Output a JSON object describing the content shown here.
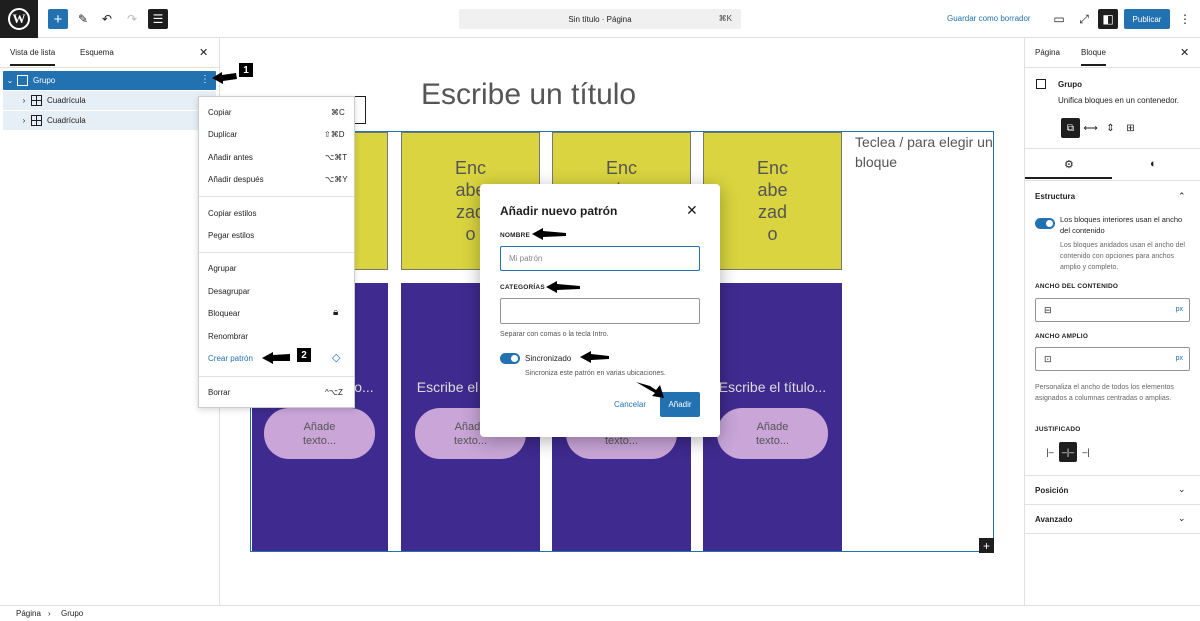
{
  "topbar": {
    "doc_title": "Sin título · Página",
    "doc_shortcut": "⌘K",
    "save_draft": "Guardar como borrador",
    "publish": "Publicar"
  },
  "left_panel": {
    "tabs": [
      "Vista de lista",
      "Esquema"
    ],
    "rows": [
      {
        "label": "Grupo",
        "icon": "group-icon",
        "selected": true
      },
      {
        "label": "Cuadrícula",
        "icon": "grid-icon"
      },
      {
        "label": "Cuadrícula",
        "icon": "grid-icon"
      }
    ]
  },
  "context_menu": {
    "items": [
      {
        "label": "Copiar",
        "shortcut": "⌘C"
      },
      {
        "label": "Duplicar",
        "shortcut": "⇧⌘D"
      },
      {
        "label": "Añadir antes",
        "shortcut": "⌥⌘T"
      },
      {
        "label": "Añadir después",
        "shortcut": "⌥⌘Y"
      },
      {
        "label": "Copiar estilos",
        "shortcut": ""
      },
      {
        "label": "Pegar estilos",
        "shortcut": ""
      },
      {
        "label": "Agrupar",
        "shortcut": ""
      },
      {
        "label": "Desagrupar",
        "shortcut": ""
      },
      {
        "label": "Bloquear",
        "shortcut": "lock-icon"
      },
      {
        "label": "Renombrar",
        "shortcut": ""
      },
      {
        "label": "Crear patrón",
        "shortcut": "pattern-icon"
      },
      {
        "label": "Borrar",
        "shortcut": "^⌥Z"
      }
    ]
  },
  "canvas": {
    "title_placeholder": "Escribe un título",
    "yellow_heading": "Enc\nabe\nzad\no",
    "purple_heading": "Escribe el título...",
    "pill_text": "Añade\ntexto...",
    "placeholder": "Teclea / para elegir un bloque",
    "colors": {
      "yellow": "#d9d43f",
      "purple": "#3f2a8f",
      "pill": "#c9a5d8"
    }
  },
  "modal": {
    "title": "Añadir nuevo patrón",
    "name_label": "NOMBRE",
    "name_placeholder": "Mi patrón",
    "categories_label": "CATEGORÍAS",
    "categories_help": "Separar con comas o la tecla Intro.",
    "sync_label": "Sincronizado",
    "sync_help": "Sincroniza este patrón en varias ubicaciones.",
    "cancel": "Cancelar",
    "add": "Añadir"
  },
  "right_panel": {
    "tabs": [
      "Página",
      "Bloque"
    ],
    "block_name": "Grupo",
    "block_desc": "Unifica bloques en un contenedor.",
    "structure": "Estructura",
    "inner_toggle": "Los bloques interiores usan el ancho del contenido",
    "inner_help": "Los bloques anidados usan el ancho del contenido con opciones para anchos amplio y completo.",
    "content_width_label": "ANCHO DEL CONTENIDO",
    "wide_width_label": "ANCHO AMPLIO",
    "unit": "px",
    "width_help": "Personaliza el ancho de todos los elementos asignados a columnas centradas o amplias.",
    "justify_label": "JUSTIFICADO",
    "position": "Posición",
    "advanced": "Avanzado"
  },
  "footer": {
    "crumbs": [
      "Página",
      "Grupo"
    ]
  },
  "annotations": {
    "badge1": "1",
    "badge2": "2"
  }
}
